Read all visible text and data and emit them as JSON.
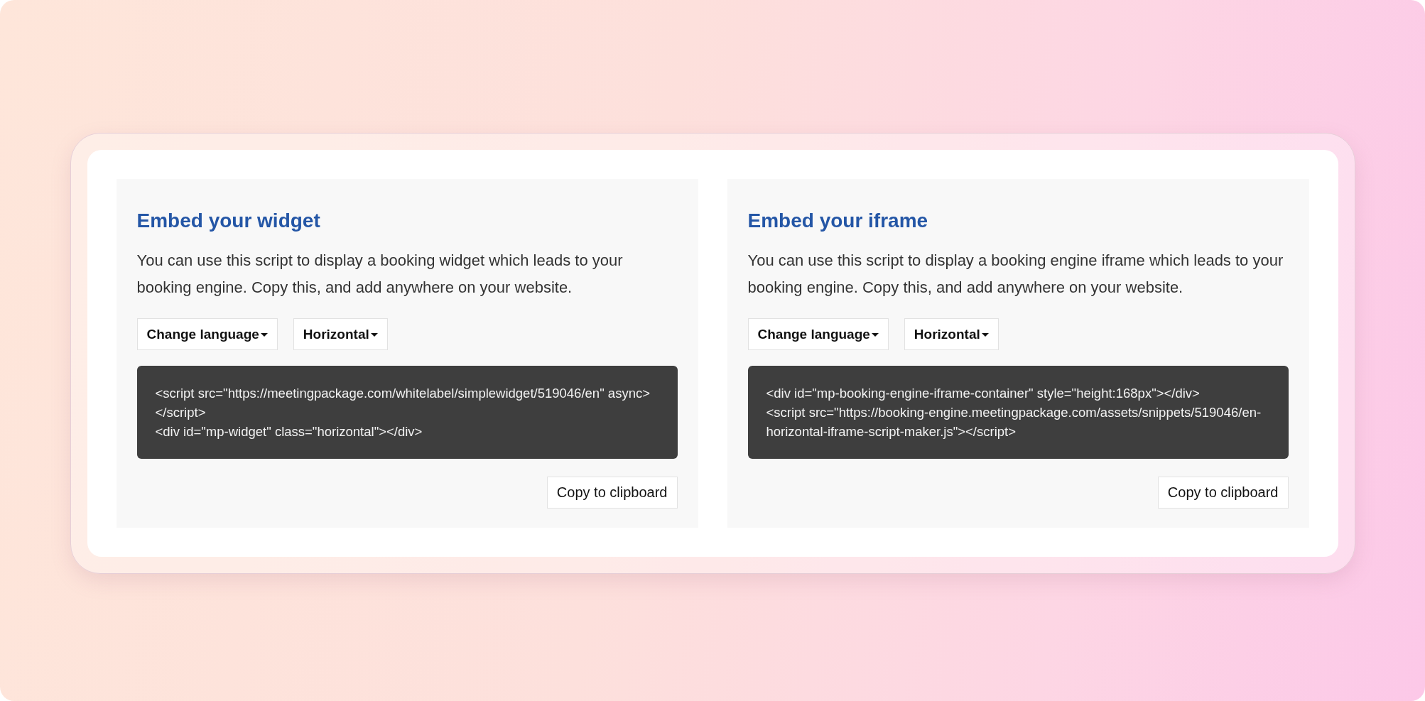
{
  "panels": [
    {
      "title": "Embed your widget",
      "description": "You can use this script to display a booking widget which leads to your booking engine. Copy this, and add anywhere on your website.",
      "dropdowns": [
        {
          "label": "Change language"
        },
        {
          "label": "Horizontal"
        }
      ],
      "code_lines": [
        "<script src=\"https://meetingpackage.com/whitelabel/simplewidget/519046/en\" async>",
        "</script>",
        "<div id=\"mp-widget\" class=\"horizontal\"></div>"
      ],
      "copy_button": "Copy to clipboard"
    },
    {
      "title": "Embed your iframe",
      "description": "You can use this script to display a booking engine iframe which leads to your booking engine. Copy this, and add anywhere on your website.",
      "dropdowns": [
        {
          "label": "Change language"
        },
        {
          "label": "Horizontal"
        }
      ],
      "code_lines": [
        "<div id=\"mp-booking-engine-iframe-container\" style=\"height:168px\"></div>",
        "<script src=\"https://booking-engine.meetingpackage.com/assets/snippets/519046/en-",
        "horizontal-iframe-script-maker.js\"></script>"
      ],
      "copy_button": "Copy to clipboard"
    }
  ]
}
